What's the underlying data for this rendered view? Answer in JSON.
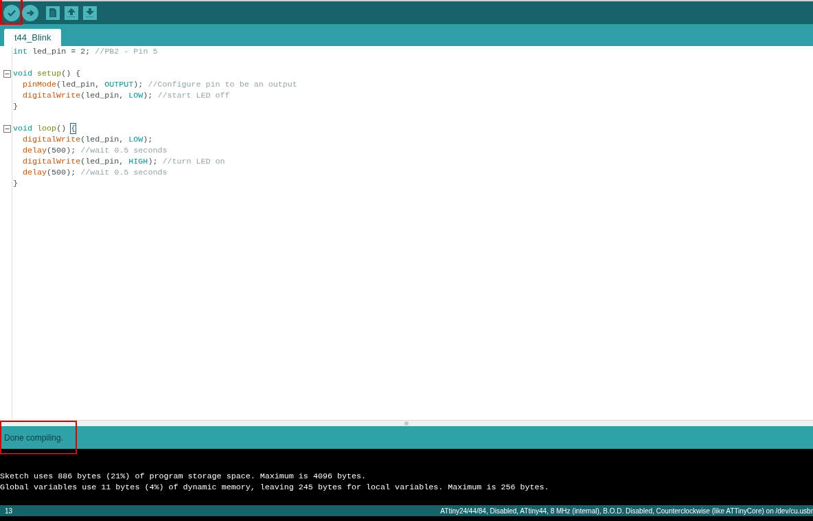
{
  "toolbar": {
    "buttons": [
      {
        "kind": "verify",
        "highlighted": true
      },
      {
        "kind": "upload",
        "highlighted": false
      },
      {
        "kind": "new",
        "highlighted": false
      },
      {
        "kind": "open",
        "highlighted": false
      },
      {
        "kind": "save",
        "highlighted": false
      }
    ]
  },
  "tabs": [
    {
      "label": "t44_Blink",
      "selected": true
    }
  ],
  "editor": {
    "lines": [
      {
        "fold": false,
        "indented": false,
        "tokens": [
          {
            "kind": "type",
            "text": "int"
          },
          {
            "kind": "plain",
            "text": " led_pin = 2; "
          },
          {
            "kind": "comment",
            "text": "//PB2 - Pin 5"
          }
        ]
      },
      {
        "fold": false,
        "indented": false
      },
      {
        "fold": true,
        "indented": false,
        "tokens": [
          {
            "kind": "type",
            "text": "void "
          },
          {
            "kind": "structure",
            "text": "setup"
          },
          {
            "kind": "plain",
            "text": "() {"
          }
        ]
      },
      {
        "fold": false,
        "indented": true,
        "tokens": [
          {
            "kind": "function",
            "text": "pinMode"
          },
          {
            "kind": "plain",
            "text": "(led_pin, "
          },
          {
            "kind": "constant",
            "text": "OUTPUT"
          },
          {
            "kind": "plain",
            "text": "); "
          },
          {
            "kind": "comment",
            "text": "//Configure pin to be an output"
          }
        ]
      },
      {
        "fold": false,
        "indented": true,
        "tokens": [
          {
            "kind": "function",
            "text": "digitalWrite"
          },
          {
            "kind": "plain",
            "text": "(led_pin, "
          },
          {
            "kind": "constant",
            "text": "LOW"
          },
          {
            "kind": "plain",
            "text": "); "
          },
          {
            "kind": "comment",
            "text": "//start LED off"
          }
        ]
      },
      {
        "fold": false,
        "indented": false,
        "tokens": [
          {
            "kind": "plain",
            "text": "}"
          }
        ]
      },
      {
        "fold": false,
        "indented": false
      },
      {
        "fold": true,
        "indented": false,
        "tokens": [
          {
            "kind": "type",
            "text": "void "
          },
          {
            "kind": "structure",
            "text": "loop"
          },
          {
            "kind": "plain",
            "text": "() "
          },
          {
            "kind": "bracket",
            "text": "{"
          }
        ]
      },
      {
        "fold": false,
        "indented": true,
        "tokens": [
          {
            "kind": "function",
            "text": "digitalWrite"
          },
          {
            "kind": "plain",
            "text": "(led_pin, "
          },
          {
            "kind": "constant",
            "text": "LOW"
          },
          {
            "kind": "plain",
            "text": ");"
          }
        ]
      },
      {
        "fold": false,
        "indented": true,
        "tokens": [
          {
            "kind": "function",
            "text": "delay"
          },
          {
            "kind": "plain",
            "text": "(500); "
          },
          {
            "kind": "comment",
            "text": "//wait 0.5 seconds"
          }
        ]
      },
      {
        "fold": false,
        "indented": true,
        "tokens": [
          {
            "kind": "function",
            "text": "digitalWrite"
          },
          {
            "kind": "plain",
            "text": "(led_pin, "
          },
          {
            "kind": "constant",
            "text": "HIGH"
          },
          {
            "kind": "plain",
            "text": "); "
          },
          {
            "kind": "comment",
            "text": "//turn LED on"
          }
        ]
      },
      {
        "fold": false,
        "indented": true,
        "tokens": [
          {
            "kind": "function",
            "text": "delay"
          },
          {
            "kind": "plain",
            "text": "(500); "
          },
          {
            "kind": "comment",
            "text": "//wait 0.5 seconds"
          }
        ]
      },
      {
        "fold": false,
        "indented": false,
        "tokens": [
          {
            "kind": "plain",
            "text": "}"
          }
        ]
      }
    ]
  },
  "status": {
    "message": "Done compiling.",
    "highlighted": true
  },
  "console": {
    "lines": [
      "Sketch uses 886 bytes (21%) of program storage space. Maximum is 4096 bytes.",
      "Global variables use 11 bytes (4%) of dynamic memory, leaving 245 bytes for local variables. Maximum is 256 bytes."
    ]
  },
  "status_bar": {
    "line_number": "13",
    "board": "ATtiny24/44/84, Disabled, ATtiny44, 8 MHz (internal), B.O.D. Disabled, Counterclockwise (like ATTinyCore) on /dev/cu.usbr"
  }
}
